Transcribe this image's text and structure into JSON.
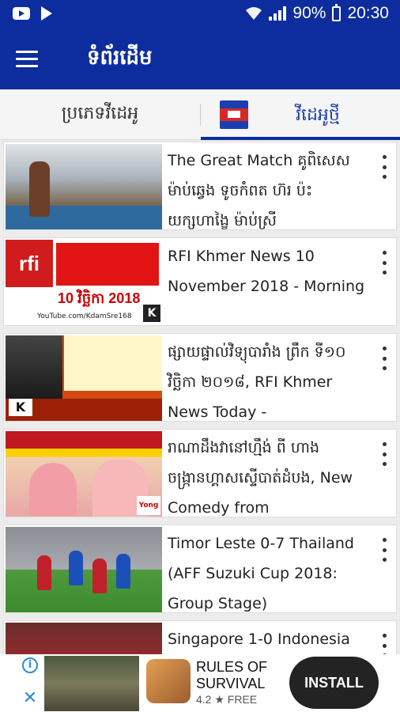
{
  "status_bar": {
    "battery": "90%",
    "time": "20:30",
    "icons": [
      "youtube-icon",
      "play-store-icon",
      "wifi-icon",
      "signal-icon",
      "battery-icon"
    ]
  },
  "app_bar": {
    "title": "ទំព័រដើម",
    "menu_icon": "hamburger-menu-icon"
  },
  "tabs": [
    {
      "label": "ប្រភេទវីដេអូ",
      "selected": false
    },
    {
      "label": "វីដេអូថ្មី",
      "selected": true,
      "icon": "cambodia-flag-icon"
    }
  ],
  "videos": [
    {
      "title": "The Great Match គូពិសេស ម៉ាប់ឆ្វេង ទូចកំពត ហ៊រ ប៉ះ យក្សហាង្ខៃ ម៉ាប់ស្រី"
    },
    {
      "title": "RFI Khmer News 10 November 2018 - Morning",
      "thumb_text": {
        "logo": "rfi",
        "date": "10 វិច្ឆិកា 2018",
        "channel": "YouTube.com/KdamSre168",
        "badge": "K"
      }
    },
    {
      "title": "ផ្សាយផ្ទាល់វិទ្យុបារាំង ព្រឹក ទី១០ វិច្ឆិកា ២០១៨, RFI Khmer News Today -",
      "thumb_text": {
        "badge": "K"
      }
    },
    {
      "title": "រាណាដឹងវានៅហ្មឹង់ ពី ហាង ចង្រ្កានហ្គាសស្ទើបាត់ដំបង, New Comedy from",
      "thumb_text": {
        "badge": "Yong"
      }
    },
    {
      "title": "Timor Leste 0-7 Thailand (AFF Suzuki Cup 2018: Group Stage)"
    },
    {
      "title": "Singapore 1-0 Indonesia"
    }
  ],
  "ad": {
    "app_name": "RULES OF SURVIVAL",
    "rating": "4.2 ★ FREE",
    "install_label": "INSTALL",
    "info_label": "i",
    "close_label": "✕"
  },
  "colors": {
    "primary": "#0d2d9e",
    "tab_active": "#1b3fb0",
    "background": "#ececec"
  }
}
